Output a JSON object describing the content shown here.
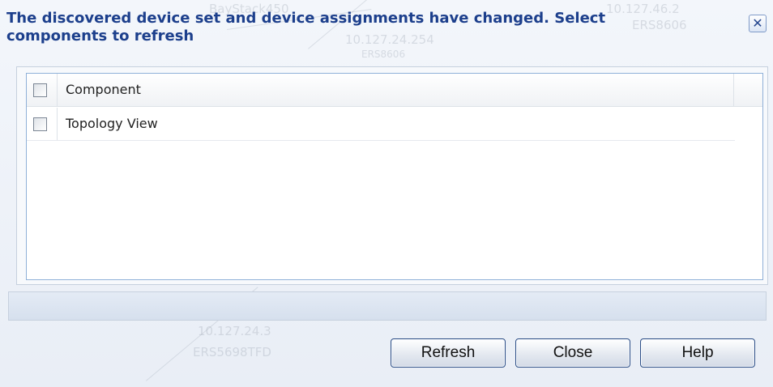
{
  "dialog": {
    "title": "The discovered device set and device assignments have changed. Select components to refresh",
    "close_glyph": "✕"
  },
  "background_watermark": {
    "labels": [
      "BayStack450",
      "10.127.24.254",
      "ERS8606",
      "10.127.46.2",
      "ERS8606",
      "10.127.24.3",
      "ERS5698TFD"
    ]
  },
  "table": {
    "header": {
      "label": "Component",
      "checked": false
    },
    "rows": [
      {
        "label": "Topology View",
        "checked": false
      }
    ]
  },
  "buttons": {
    "refresh": "Refresh",
    "close": "Close",
    "help": "Help"
  },
  "icons": {
    "close": "close-icon",
    "checkbox": "checkbox-icon"
  },
  "colors": {
    "title": "#1c3f8c",
    "grid_border": "#8fb0d8",
    "button_border": "#2e4f87"
  }
}
